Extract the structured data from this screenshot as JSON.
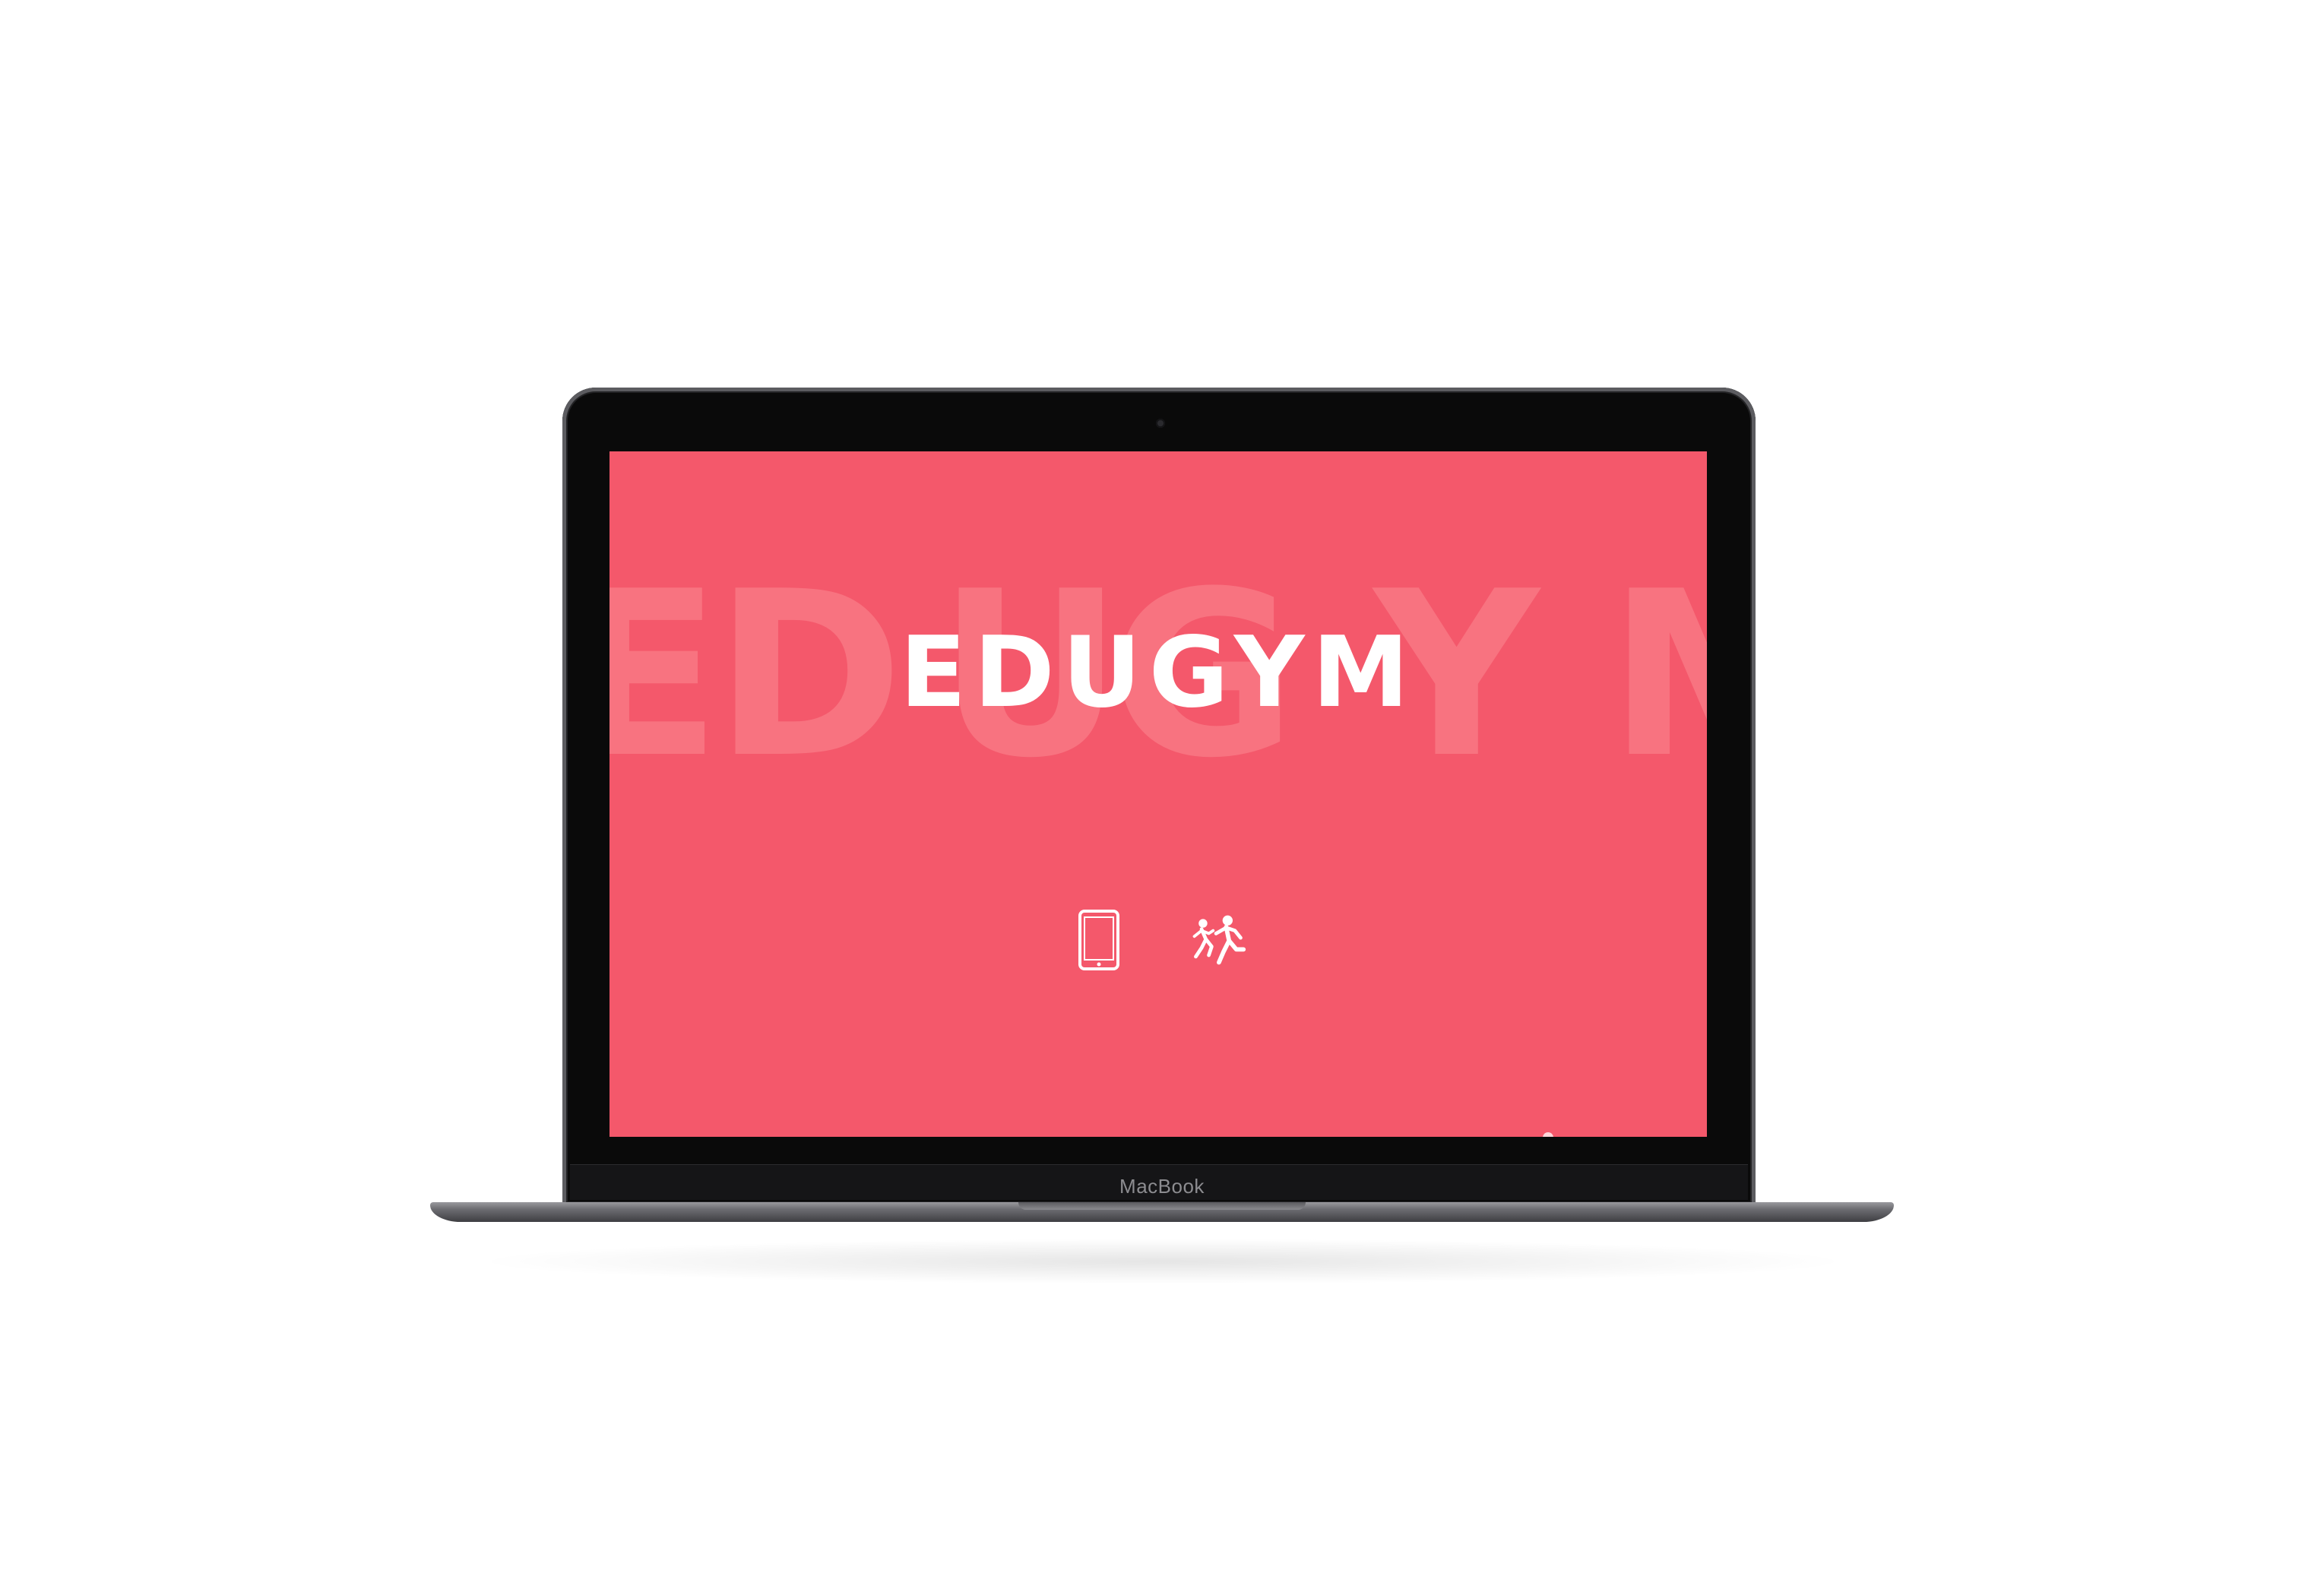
{
  "device": {
    "brand_label": "MacBook"
  },
  "website": {
    "title": "EDUGYM",
    "background_letters": [
      "E",
      "D",
      "U",
      "G",
      "Y",
      "M"
    ],
    "icons": [
      {
        "name": "tablet-icon"
      },
      {
        "name": "running-kids-icon"
      }
    ]
  },
  "colors": {
    "brand_background": "#f4586b",
    "background_letter": "#f87380",
    "title": "#ffffff",
    "icon": "#ffffff"
  }
}
